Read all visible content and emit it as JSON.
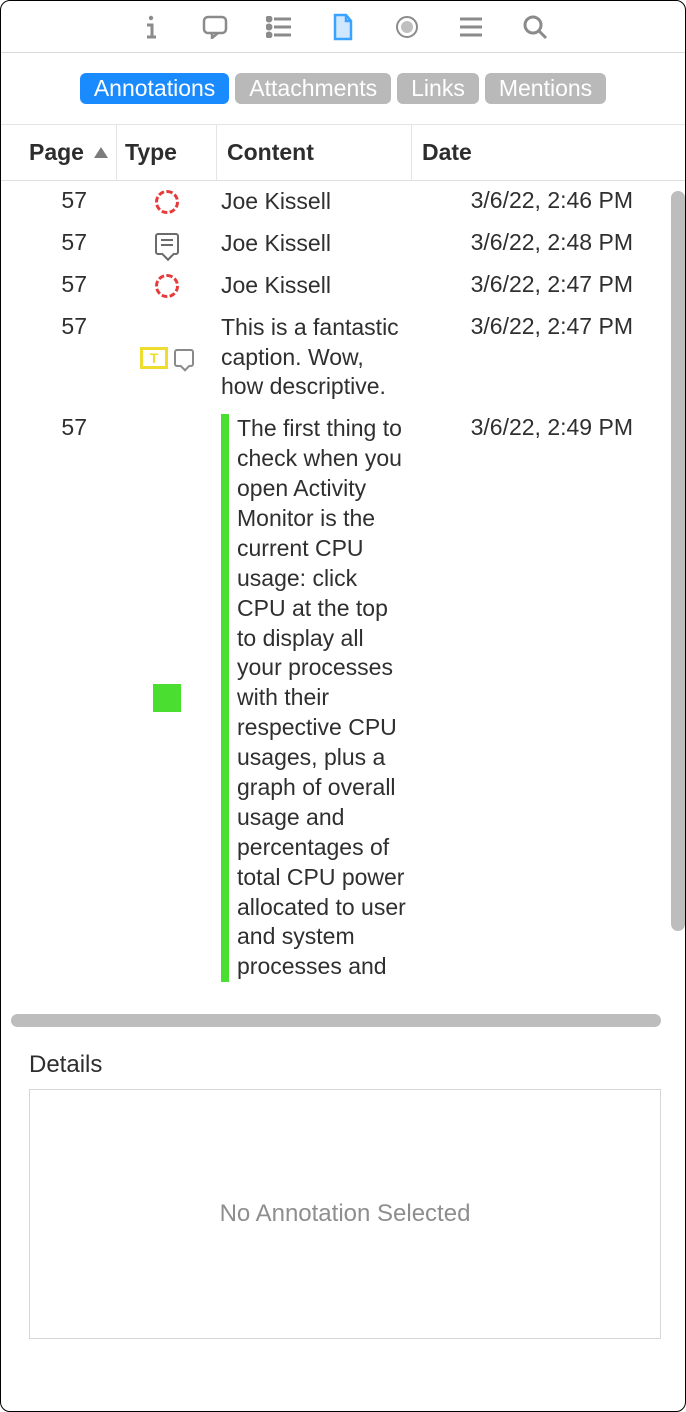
{
  "tabs": {
    "items": [
      {
        "label": "Annotations",
        "active": true
      },
      {
        "label": "Attachments",
        "active": false
      },
      {
        "label": "Links",
        "active": false
      },
      {
        "label": "Mentions",
        "active": false
      }
    ]
  },
  "columns": {
    "page": "Page",
    "type": "Type",
    "content": "Content",
    "date": "Date"
  },
  "rows": [
    {
      "page": "57",
      "icon": "circle",
      "content": "Joe Kissell",
      "date": "3/6/22, 2:46 PM"
    },
    {
      "page": "57",
      "icon": "note",
      "content": "Joe Kissell",
      "date": "3/6/22, 2:48 PM"
    },
    {
      "page": "57",
      "icon": "circle",
      "content": "Joe Kissell",
      "date": "3/6/22, 2:47 PM"
    },
    {
      "page": "57",
      "icon": "textbox-comment",
      "content": "This is a fantastic caption. Wow, how descriptive.",
      "date": "3/6/22, 2:47 PM"
    },
    {
      "page": "57",
      "icon": "highlight",
      "content": "The first thing to check when you open Activity Monitor is the current CPU usage: click CPU at the top to display all your processes with their respective CPU usages, plus a graph of overall usage and percentages of total CPU power allocated to user and system processes and",
      "date": "3/6/22, 2:49 PM"
    }
  ],
  "details": {
    "title": "Details",
    "empty": "No Annotation Selected"
  }
}
